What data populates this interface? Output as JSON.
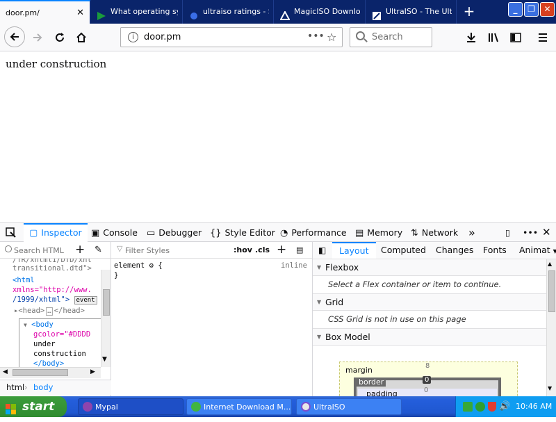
{
  "browser": {
    "tabs": [
      {
        "label": "door.pm/",
        "active": true
      },
      {
        "label": "What operating sy",
        "active": false
      },
      {
        "label": "ultraiso ratings - S",
        "active": false
      },
      {
        "label": "MagicISO Downlo",
        "active": false
      },
      {
        "label": "UltraISO - The Ult",
        "active": false
      }
    ],
    "new_tab": "+",
    "url": "door.pm",
    "search_placeholder": "Search"
  },
  "page": {
    "text": "under construction"
  },
  "devtools": {
    "tabs": [
      "Inspector",
      "Console",
      "Debugger",
      "Style Editor",
      "Performance",
      "Memory",
      "Network"
    ],
    "search_html_placeholder": "Search HTML",
    "markup_lines": [
      "/TR/xhtml1/DTD/xht",
      "transitional.dtd\">",
      "<html",
      "xmlns=\"http://www.",
      "/1999/xhtml\">",
      "event",
      "<head>",
      "</head>",
      "<body",
      "gcolor=\"#DDDD",
      "under",
      "construction",
      "</body>"
    ],
    "breadcrumbs": [
      "html",
      "body"
    ],
    "rules": {
      "filter_placeholder": "Filter Styles",
      "hov": ":hov",
      "cls": ".cls",
      "element_rule": "element",
      "open_brace": "{",
      "close_brace": "}",
      "inline": "inline"
    },
    "layout": {
      "subtabs": [
        "Layout",
        "Computed",
        "Changes",
        "Fonts",
        "Animat"
      ],
      "flexbox_title": "Flexbox",
      "flexbox_msg": "Select a Flex container or item to continue.",
      "grid_title": "Grid",
      "grid_msg": "CSS Grid is not in use on this page",
      "boxmodel_title": "Box Model",
      "margin_label": "margin",
      "margin_top": "8",
      "border_label": "border",
      "border_top": "0",
      "padding_label": "padding",
      "padding_top": "0"
    }
  },
  "taskbar": {
    "start": "start",
    "items": [
      "Mypal",
      "Internet Download M...",
      "UltraISO"
    ],
    "clock": "10:46 AM"
  }
}
